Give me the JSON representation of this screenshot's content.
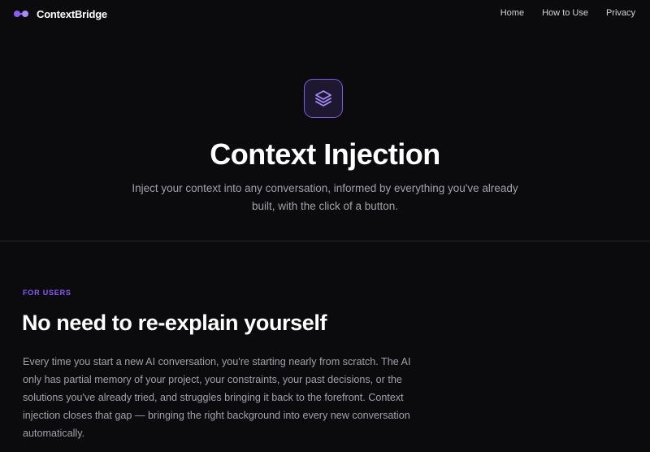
{
  "nav": {
    "brand": "ContextBridge",
    "links": [
      "Home",
      "How to Use",
      "Privacy"
    ]
  },
  "hero": {
    "icon": "layers-icon",
    "title": "Context Injection",
    "subtitle": "Inject your context into any conversation, informed by everything you've already built, with the click of a button."
  },
  "section": {
    "eyebrow": "FOR USERS",
    "title": "No need to re-explain yourself",
    "body": "Every time you start a new AI conversation, you're starting nearly from scratch. The AI only has partial memory of your project, your constraints, your past decisions, or the solutions you've already tried, and struggles bringing it back to the forefront. Context injection closes that gap — bringing the right background into every new conversation automatically."
  },
  "colors": {
    "background": "#0b0b0d",
    "accent": "#8b5cf6",
    "muted_text": "#a1a1aa"
  }
}
